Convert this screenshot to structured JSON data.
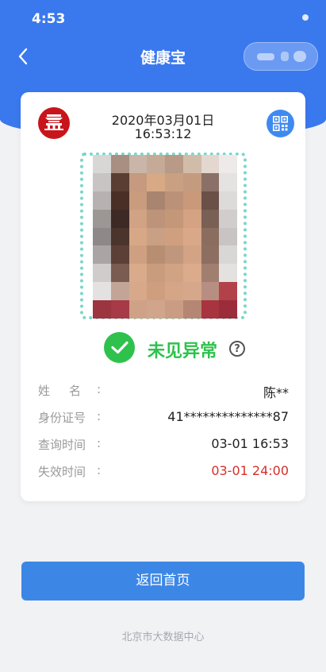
{
  "status_bar": {
    "time": "4:53"
  },
  "nav": {
    "title": "健康宝"
  },
  "card": {
    "date": "2020年03月01日",
    "time": "16:53:12",
    "status_text": "未见异常",
    "help_symbol": "?",
    "rows": [
      {
        "label": "姓名",
        "colon": ":",
        "value": "陈**",
        "value_color": "#222222"
      },
      {
        "label": "身份证号",
        "colon": ":",
        "value": "41**************87",
        "value_color": "#222222"
      },
      {
        "label": "查询时间",
        "colon": ":",
        "value": "03-01 16:53",
        "value_color": "#222222"
      },
      {
        "label": "失效时间",
        "colon": ":",
        "value": "03-01 24:00",
        "value_color": "#d6302a"
      }
    ]
  },
  "home_button": {
    "label": "返回首页"
  },
  "footer": {
    "text": "北京市大数据中心"
  },
  "icons": {
    "back": "chevron-left-icon",
    "qr": "qr-code-icon",
    "check": "check-icon",
    "help": "help-icon",
    "emblem": "tiananmen-emblem-icon"
  },
  "colors": {
    "header": "#3a78ee",
    "ok_green": "#2ec24d",
    "button": "#3c87e6",
    "expire_red": "#d6302a"
  }
}
